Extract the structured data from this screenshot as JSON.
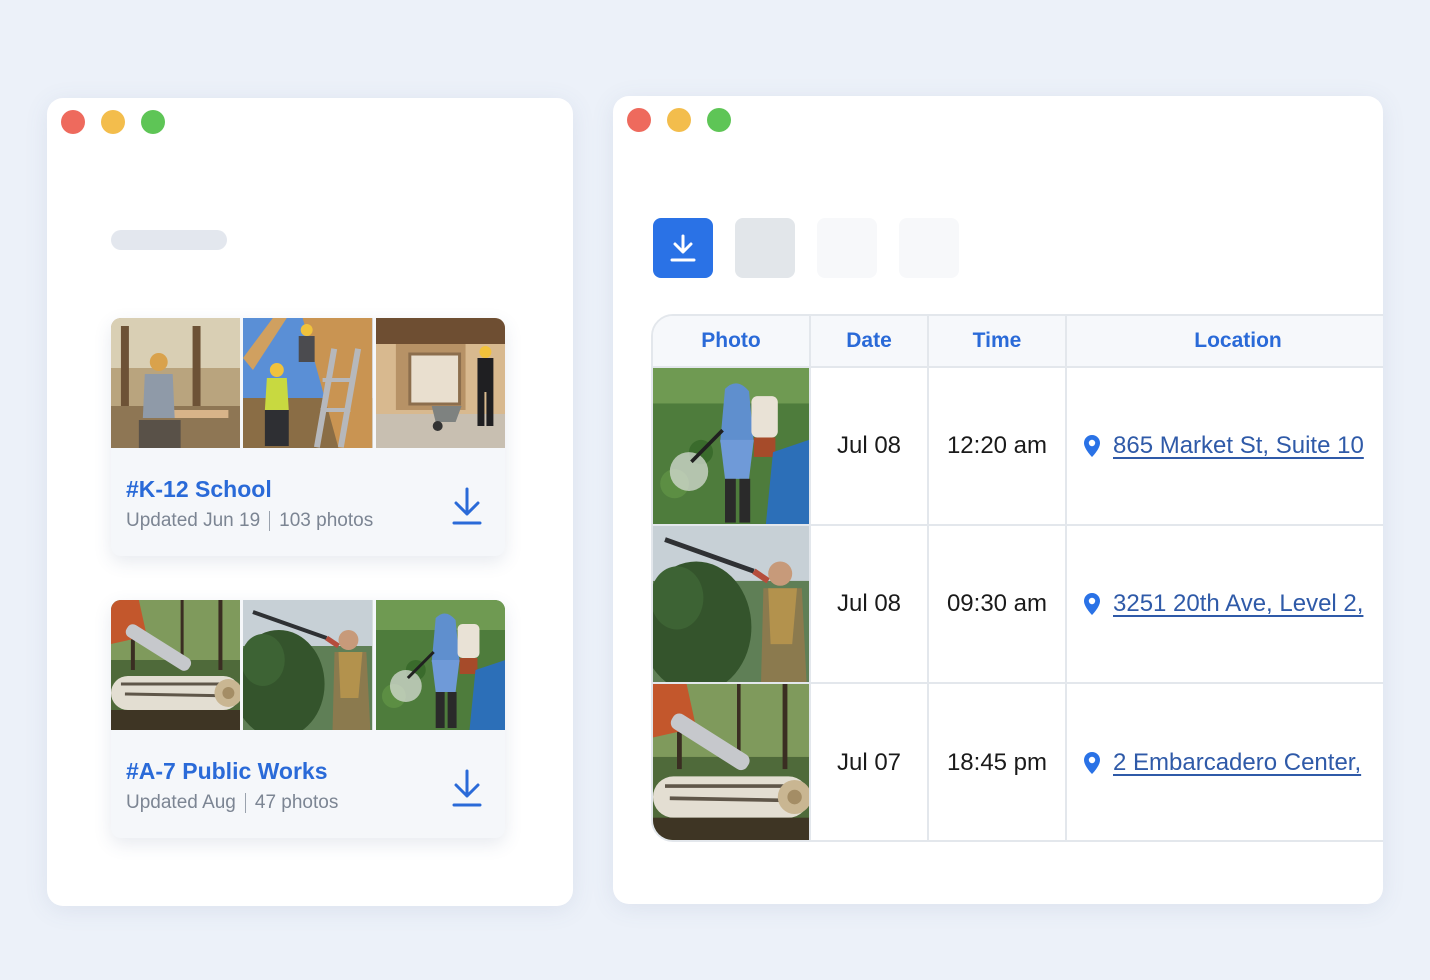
{
  "albums_window": {
    "albums": [
      {
        "title": "#K-12 School",
        "updated": "Updated Jun 19",
        "photo_count": "103 photos",
        "thumbnails": [
          "carpenter-sawing-photo",
          "worker-on-ladder-photo",
          "worker-with-wheelbarrow-photo"
        ]
      },
      {
        "title": "#A-7 Public Works",
        "updated": "Updated Aug",
        "photo_count": "47 photos",
        "thumbnails": [
          "chainsaw-cutting-logs-photo",
          "man-pruning-hedge-photo",
          "man-spraying-plants-photo"
        ]
      }
    ]
  },
  "table_window": {
    "toolbar": [
      "download-icon",
      "",
      "",
      ""
    ],
    "columns": [
      "Photo",
      "Date",
      "Time",
      "Location"
    ],
    "rows": [
      {
        "photo": "man-spraying-plants-photo",
        "date": "Jul 08",
        "time": "12:20 am",
        "location": "865 Market St, Suite 10"
      },
      {
        "photo": "man-pruning-hedge-photo",
        "date": "Jul 08",
        "time": "09:30 am",
        "location": "3251 20th Ave, Level 2,"
      },
      {
        "photo": "chainsaw-cutting-logs-photo",
        "date": "Jul 07",
        "time": "18:45 pm",
        "location": "2 Embarcadero Center,"
      }
    ]
  },
  "colors": {
    "accent": "#2a6ad8",
    "primary_button": "#2a72e6",
    "link": "#2f5aa8",
    "page_background": "#ecf1f9"
  }
}
